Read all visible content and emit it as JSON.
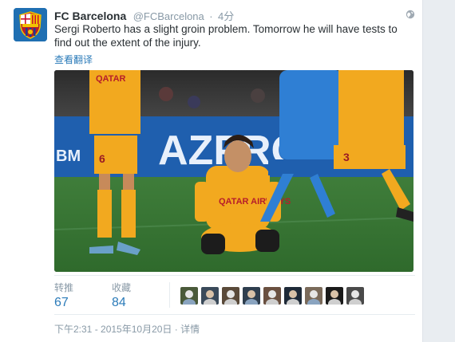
{
  "tweet": {
    "display_name": "FC Barcelona",
    "handle": "@FCBarcelona",
    "separator": "·",
    "time_ago": "4分",
    "text": "Sergi Roberto has a slight groin problem. Tomorrow he will have tests to find out the extent of the injury.",
    "translate_label": "查看翻译"
  },
  "media": {
    "jersey_text": "QATAR AIRWAYS",
    "banner_text": "AZPROM",
    "banner_side_text": "BM",
    "sponsor_text": "QATAR",
    "numbers": [
      "6",
      "3"
    ]
  },
  "stats": {
    "retweets_label": "转推",
    "retweets_count": "67",
    "likes_label": "收藏",
    "likes_count": "84"
  },
  "likers": [
    {
      "name": "liker-1",
      "color": "#4a5a3a"
    },
    {
      "name": "liker-2",
      "color": "#3a4a5a"
    },
    {
      "name": "liker-3",
      "color": "#5a4a3a"
    },
    {
      "name": "liker-4",
      "color": "#2e3e4e"
    },
    {
      "name": "liker-5",
      "color": "#6a5040"
    },
    {
      "name": "liker-6",
      "color": "#1e2a38"
    },
    {
      "name": "liker-7",
      "color": "#7a6a5a"
    },
    {
      "name": "liker-8",
      "color": "#1a1a1a"
    },
    {
      "name": "liker-9",
      "color": "#4a4a4a"
    }
  ],
  "footer": {
    "timestamp": "下午2:31 - 2015年10月20日",
    "separator": "·",
    "details_label": "详情"
  },
  "colors": {
    "link": "#2b7bb9",
    "muted": "#8899a6",
    "text": "#292f33"
  }
}
